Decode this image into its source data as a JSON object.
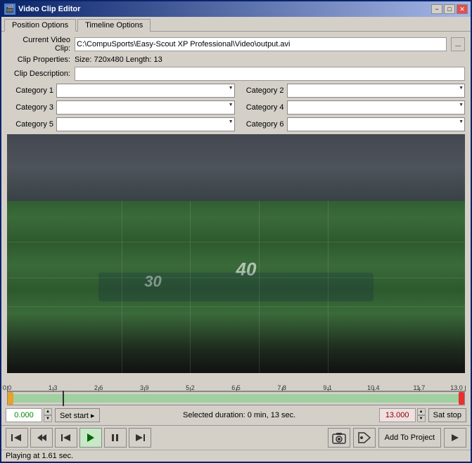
{
  "window": {
    "title": "Video Clip Editor",
    "min_label": "−",
    "max_label": "□",
    "close_label": "✕"
  },
  "tabs": [
    {
      "id": "position",
      "label": "Position Options",
      "active": true
    },
    {
      "id": "timeline",
      "label": "Timeline Options",
      "active": false
    }
  ],
  "form": {
    "current_video_clip_label": "Current Video Clip:",
    "current_video_clip_value": "C:\\CompuSports\\Easy-Scout XP Professional\\Video\\output.avi",
    "browse_label": "...",
    "clip_properties_label": "Clip Properties:",
    "clip_properties_value": "Size: 720x480    Length: 13",
    "clip_description_label": "Clip Description:"
  },
  "categories": [
    {
      "label": "Category 1",
      "value": ""
    },
    {
      "label": "Category 2",
      "value": ""
    },
    {
      "label": "Category 3",
      "value": ""
    },
    {
      "label": "Category 4",
      "value": ""
    },
    {
      "label": "Category 5",
      "value": ""
    },
    {
      "label": "Category 6",
      "value": ""
    }
  ],
  "timeline": {
    "ruler_labels": [
      "0.0",
      "1.3",
      "2.6",
      "3.9",
      "5.2",
      "6.5",
      "7.8",
      "9.1",
      "10.4",
      "11.7",
      "13.0"
    ],
    "start_time": "0.000",
    "end_time": "13.000",
    "set_start_label": "Set start ▸",
    "set_stop_label": "Sat stop",
    "duration_label": "Selected duration: 0 min, 13 sec."
  },
  "transport": {
    "btn_skip_start": "⏮",
    "btn_prev_frame": "⏪",
    "btn_back": "◀",
    "btn_play": "▶",
    "btn_pause": "⏸",
    "btn_skip_end": "⏭",
    "btn_snapshot": "📷",
    "btn_tag": "🏷",
    "btn_add_to_project": "Add To Project",
    "btn_arrow": "▶",
    "status_text": "Playing at 1.61 sec."
  }
}
